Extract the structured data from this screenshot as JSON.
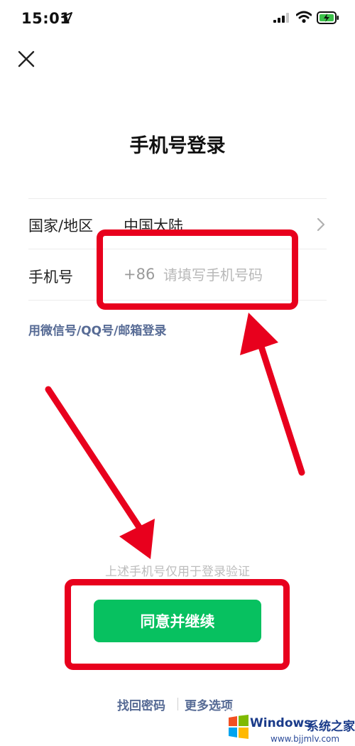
{
  "status_bar": {
    "time": "15:01"
  },
  "page": {
    "title": "手机号登录"
  },
  "form": {
    "country_label": "国家/地区",
    "country_value": "中国大陆",
    "phone_label": "手机号",
    "phone_prefix": "+86",
    "phone_placeholder": "请填写手机号码"
  },
  "alt_login_link": "用微信号/QQ号/邮箱登录",
  "notice": "上述手机号仅用于登录验证",
  "primary_button": "同意并继续",
  "footer": {
    "find_password": "找回密码",
    "more_options": "更多选项"
  },
  "watermark": {
    "brand": "Windows",
    "brand_cn": "系统之家",
    "url": "www.bjjmlv.com"
  },
  "colors": {
    "accent_green": "#07c160",
    "link_blue": "#576b95",
    "annotation_red": "#e8001d"
  },
  "icons": [
    "location-arrow-icon",
    "signal-icon",
    "wifi-icon",
    "battery-charging-icon",
    "close-icon",
    "chevron-right-icon",
    "windows-logo-icon"
  ]
}
